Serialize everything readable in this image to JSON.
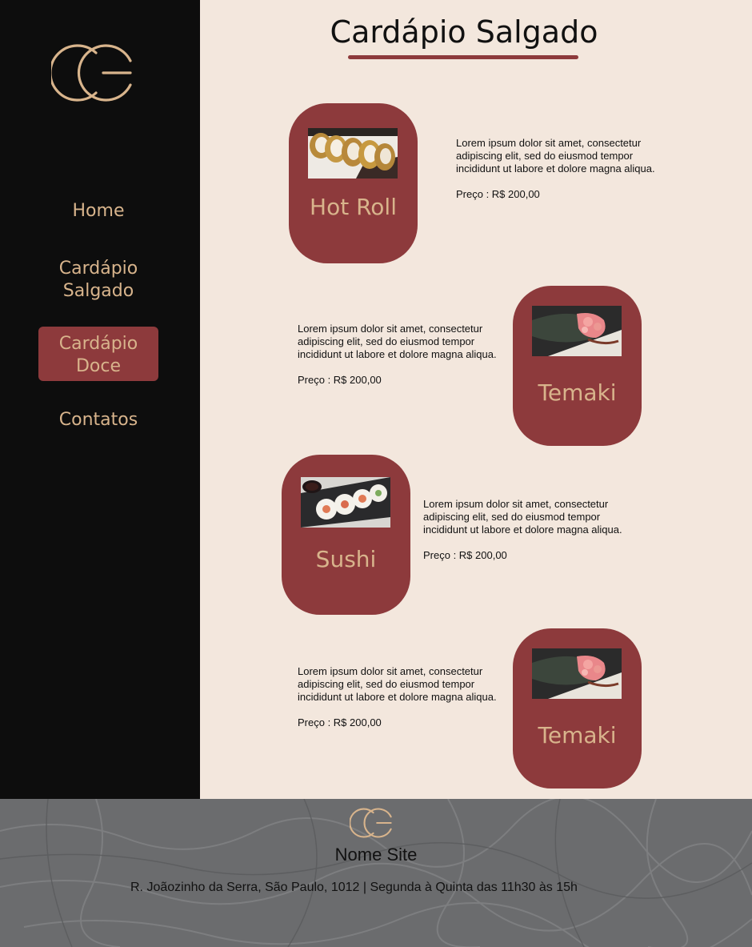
{
  "sidebar": {
    "logo_icon": "cc-logo-icon",
    "nav": [
      {
        "line1": "Home",
        "line2": ""
      },
      {
        "line1": "Cardápio",
        "line2": "Salgado"
      },
      {
        "line1": "Cardápio",
        "line2": "Doce"
      },
      {
        "line1": "Contatos",
        "line2": ""
      }
    ],
    "active_index": 2
  },
  "main": {
    "title": "Cardápio Salgado",
    "items": [
      {
        "name": "Hot Roll",
        "description": "Lorem ipsum dolor sit amet, consectetur adipiscing elit, sed do eiusmod tempor incididunt ut labore et dolore magna aliqua.",
        "price": "Preço : R$ 200,00",
        "image": "hot-roll-photo"
      },
      {
        "name": "Temaki",
        "description": "Lorem ipsum dolor sit amet, consectetur adipiscing elit, sed do eiusmod tempor incididunt ut labore et dolore magna aliqua.",
        "price": "Preço : R$ 200,00",
        "image": "temaki-photo"
      },
      {
        "name": "Sushi",
        "description": "Lorem ipsum dolor sit amet, consectetur adipiscing elit, sed do eiusmod tempor incididunt ut labore et dolore magna aliqua.",
        "price": "Preço : R$ 200,00",
        "image": "sushi-photo"
      },
      {
        "name": "Temaki",
        "description": "Lorem ipsum dolor sit amet, consectetur adipiscing elit, sed do eiusmod tempor incididunt ut labore et dolore magna aliqua.",
        "price": "Preço : R$ 200,00",
        "image": "temaki-photo"
      }
    ]
  },
  "footer": {
    "site_name": "Nome Site",
    "address": "R. Joãozinho da Serra, São Paulo, 1012  | Segunda à Quinta das 11h30 às 15h"
  },
  "colors": {
    "sidebar_bg": "#0d0d0d",
    "page_bg": "#f3e7dd",
    "accent": "#8d3a3c",
    "gold": "#d8b48c",
    "footer_bg": "#6b6c6e"
  }
}
